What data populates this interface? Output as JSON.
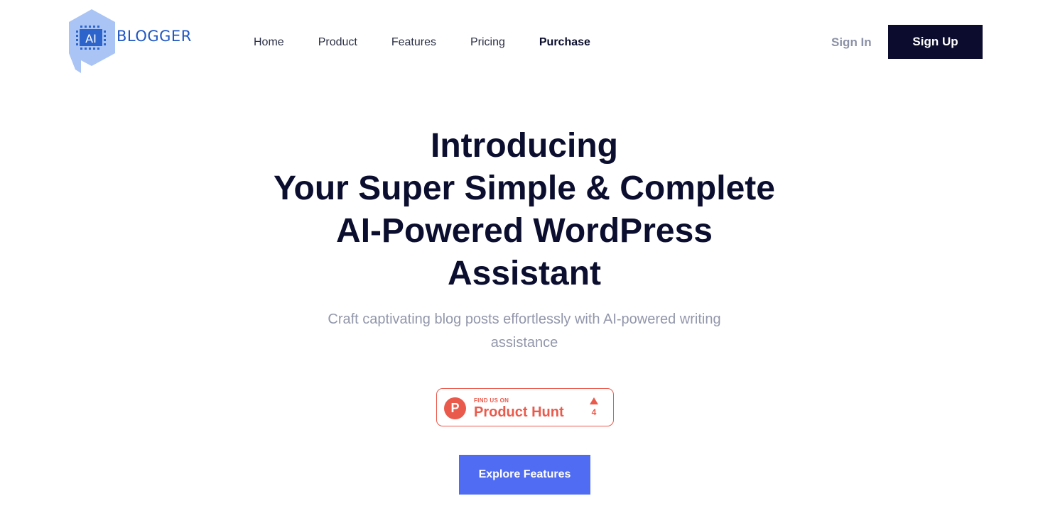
{
  "brand": {
    "icon_text": "AI",
    "name": "BLOGGER",
    "colors": {
      "hexagon": "#a9c4f5",
      "chip": "#1f57c3"
    }
  },
  "nav": {
    "items": [
      {
        "label": "Home",
        "active": false
      },
      {
        "label": "Product",
        "active": false
      },
      {
        "label": "Features",
        "active": false
      },
      {
        "label": "Pricing",
        "active": false
      },
      {
        "label": "Purchase",
        "active": true
      }
    ]
  },
  "auth": {
    "sign_in": "Sign In",
    "sign_up": "Sign Up"
  },
  "hero": {
    "title_lines": [
      "Introducing",
      "Your Super Simple & Complete",
      "AI-Powered WordPress",
      "Assistant"
    ],
    "subtitle": "Craft captivating blog posts effortlessly with AI-powered writing assistance"
  },
  "product_hunt": {
    "find_us": "FIND US ON",
    "name": "Product Hunt",
    "logo_letter": "P",
    "upvotes": "4",
    "icon": "upvote-triangle-icon",
    "color": "#ea5a4c"
  },
  "cta": {
    "label": "Explore Features",
    "color": "#4f6cf2"
  },
  "theme": {
    "dark": "#0b0c2e",
    "muted": "#9297ab"
  }
}
